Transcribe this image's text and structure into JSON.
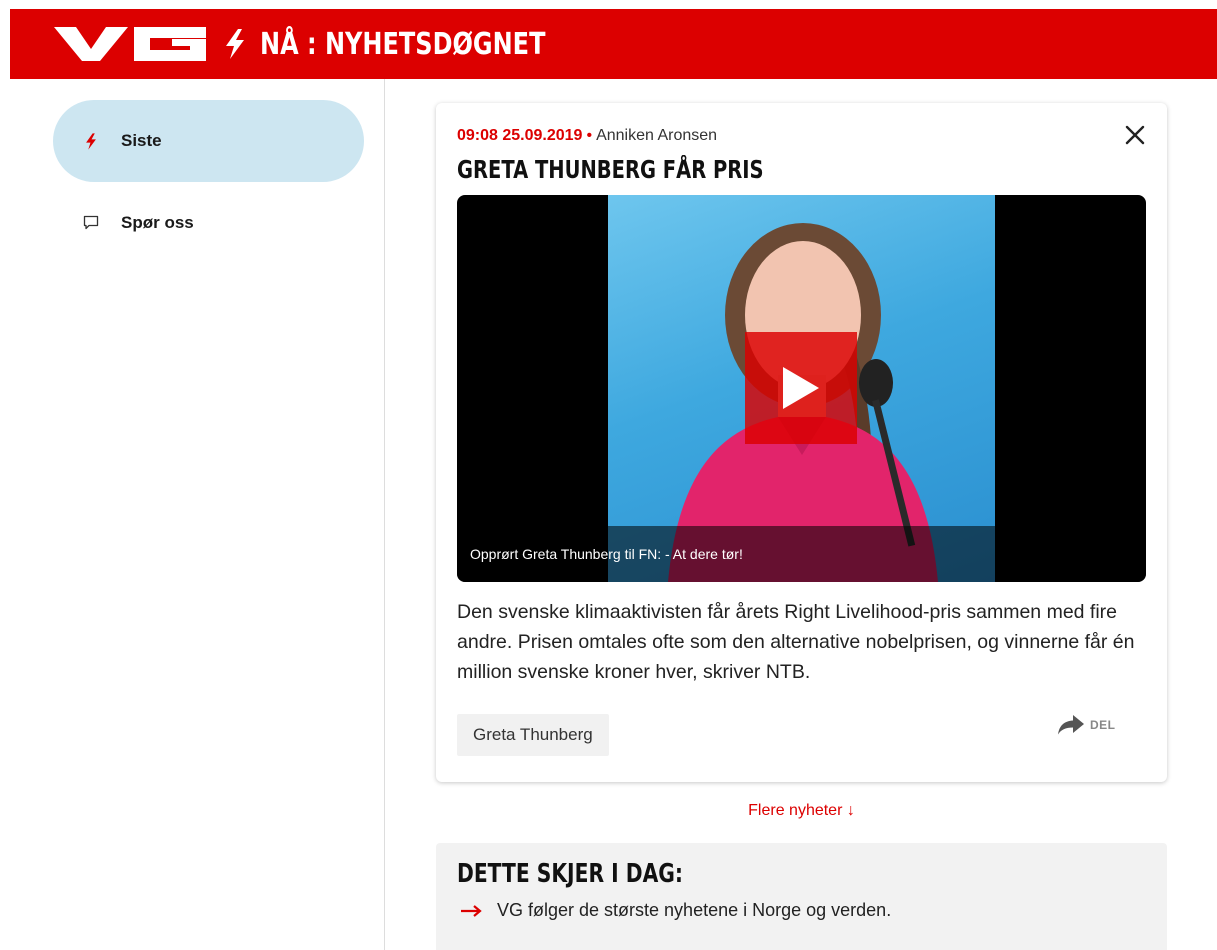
{
  "header": {
    "logo_text": "VG",
    "title": "NÅ : NYHETSDØGNET",
    "brand_color": "#dc0000"
  },
  "sidebar": {
    "items": [
      {
        "label": "Siste",
        "icon": "bolt-icon",
        "active": true
      },
      {
        "label": "Spør oss",
        "icon": "chat-bubble-icon",
        "active": false
      }
    ]
  },
  "article": {
    "time": "09:08 25.09.2019",
    "author": "Anniken Aronsen",
    "headline": "GRETA THUNBERG FÅR PRIS",
    "video_caption": "Opprørt Greta Thunberg til FN: - At dere tør!",
    "body": "Den svenske klimaaktivisten får årets Right Livelihood-pris sammen med fire andre. Prisen omtales ofte som den alternative nobelprisen, og vinnerne får én million svenske kroner hver, skriver NTB.",
    "tag": "Greta Thunberg",
    "share_label": "DEL"
  },
  "more_news": "Flere nyheter ↓",
  "today": {
    "title": "DETTE SKJER I DAG:",
    "item": "VG følger de største nyhetene i Norge og verden."
  }
}
